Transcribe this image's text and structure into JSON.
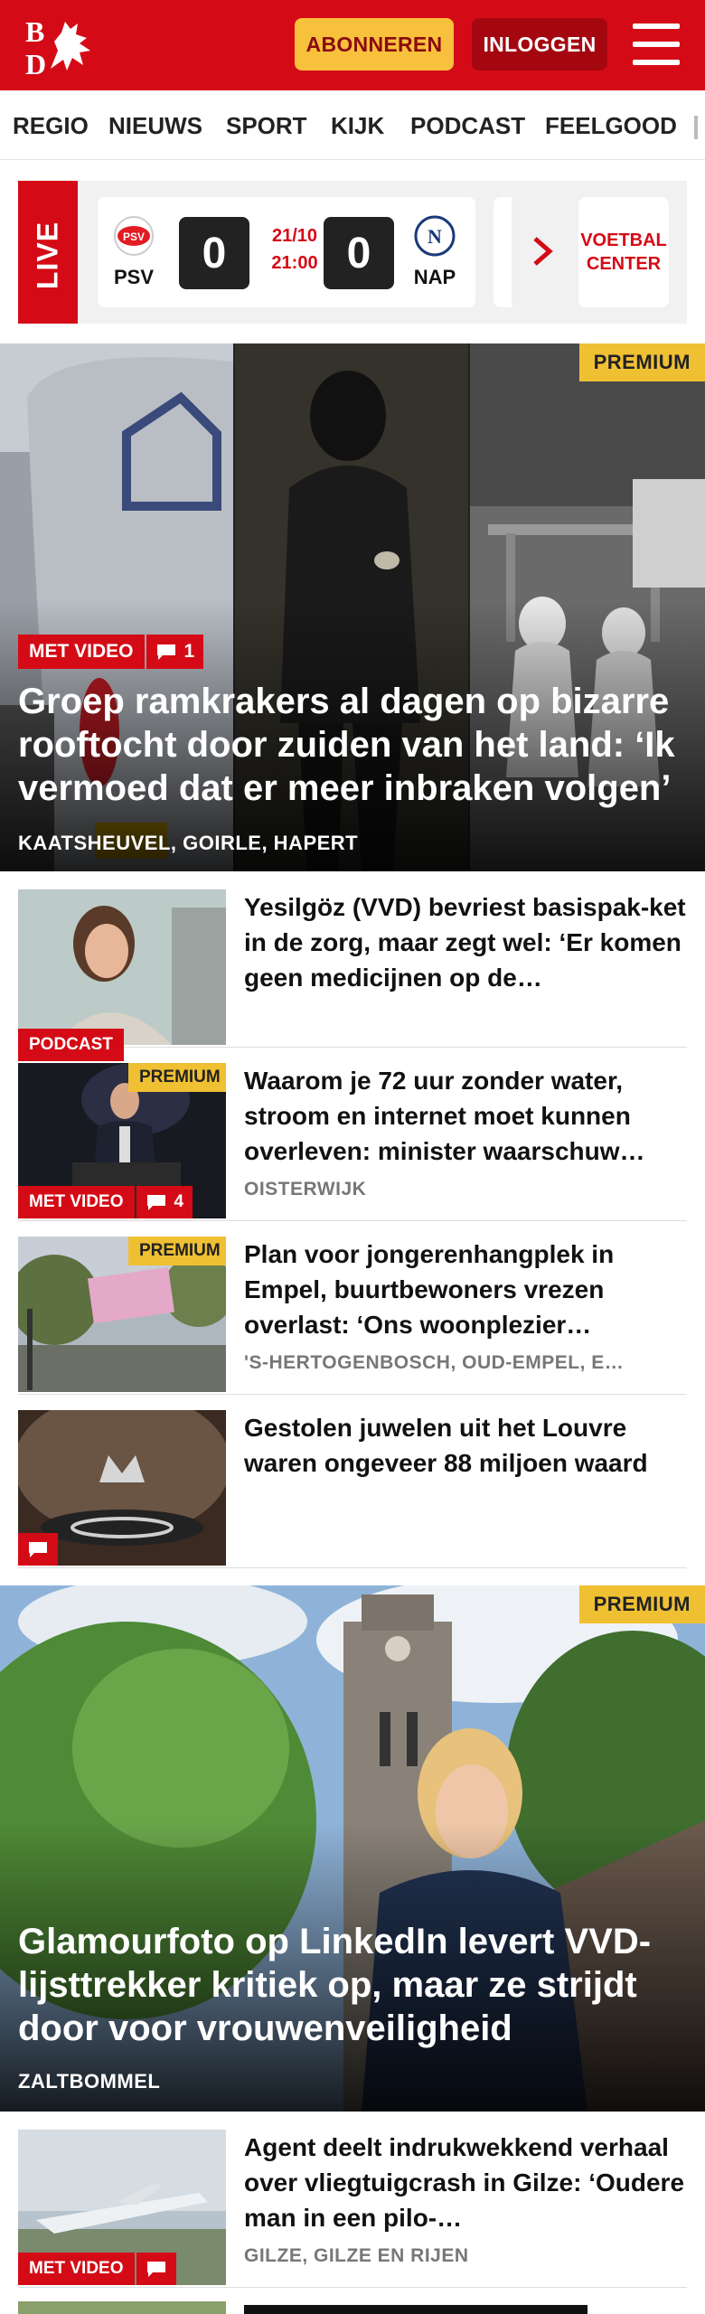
{
  "header": {
    "subscribe_label": "ABONNEREN",
    "login_label": "INLOGGEN",
    "logo_text": "BD"
  },
  "nav": {
    "items": [
      "REGIO",
      "NIEUWS",
      "SPORT",
      "KIJK",
      "PODCAST",
      "FEELGOOD"
    ]
  },
  "live": {
    "label": "LIVE",
    "match": {
      "home_team": "PSV",
      "away_team": "NAP",
      "home_score": "0",
      "away_score": "0",
      "date": "21/10",
      "time": "21:00"
    },
    "voetbal_center_label": "VOETBAL CENTER"
  },
  "hero": {
    "badge": "PREMIUM",
    "video_label": "MET VIDEO",
    "comments": "1",
    "title": "Groep ramkrakers al dagen op bizarre rooftocht door zuiden van het land: ‘Ik vermoed dat er meer inbraken volgen’",
    "location": "KAATSHEUVEL, GOIRLE, HAPERT"
  },
  "articles": [
    {
      "title": "Yesilgöz (VVD) bevriest basispak-ket in de zorg, maar zegt wel: ‘Er komen geen medicijnen op de…",
      "tag": "PODCAST",
      "location": ""
    },
    {
      "title": "Waarom je 72 uur zonder water, stroom en internet moet kunnen overleven: minister waarschuw…",
      "badge": "PREMIUM",
      "tag": "MET VIDEO",
      "comments": "4",
      "location": "OISTERWIJK"
    },
    {
      "title": "Plan voor jongerenhangplek in Empel, buurtbewoners vrezen overlast: ‘Ons woonplezier…",
      "badge": "PREMIUM",
      "location": "'S-HERTOGENBOSCH, OUD-EMPEL, E…"
    },
    {
      "title": "Gestolen juwelen uit het Louvre waren ongeveer 88 miljoen waard",
      "location": ""
    }
  ],
  "hero2": {
    "badge": "PREMIUM",
    "title": "Glamourfoto op LinkedIn levert VVD-lijsttrekker kritiek op, maar ze strijdt door voor vrouwenveiligheid",
    "location": "ZALTBOMMEL"
  },
  "articles2": [
    {
      "title": "Agent deelt indrukwekkend verhaal over vliegtuigcrash in Gilze: ‘Oudere man in een pilo-…",
      "tag": "MET VIDEO",
      "location": "GILZE, GILZE EN RIJEN"
    }
  ],
  "colors": {
    "brand_red": "#d40b16",
    "premium_yellow": "#f0c033",
    "subscribe_yellow": "#f7c13c"
  }
}
